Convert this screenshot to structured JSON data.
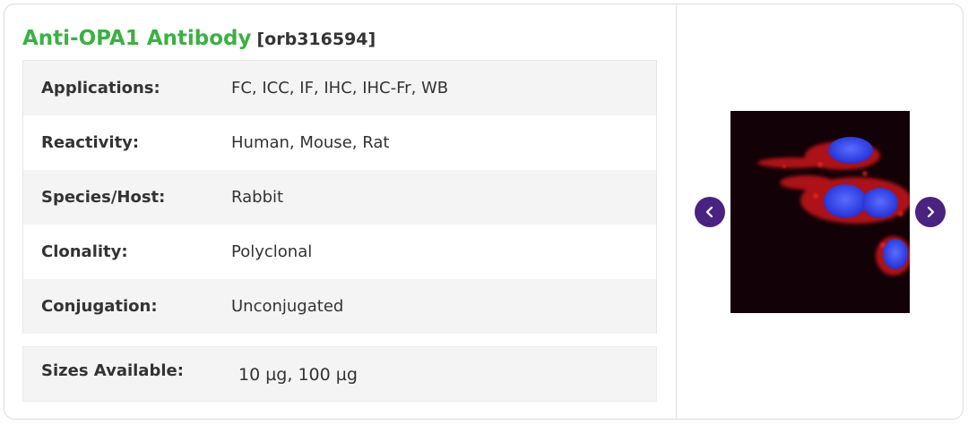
{
  "product": {
    "name": "Anti-OPA1 Antibody",
    "code": "[orb316594]"
  },
  "specs": [
    {
      "label": "Applications:",
      "value": "FC,  ICC,  IF,  IHC,  IHC-Fr,  WB"
    },
    {
      "label": "Reactivity:",
      "value": "Human, Mouse, Rat"
    },
    {
      "label": "Species/Host:",
      "value": "Rabbit"
    },
    {
      "label": "Clonality:",
      "value": "Polyclonal"
    },
    {
      "label": "Conjugation:",
      "value": "Unconjugated"
    }
  ],
  "sizes": {
    "label": "Sizes Available:",
    "value": "10 µg, 100 µg"
  },
  "gallery": {
    "prev_icon": "chevron-left-icon",
    "next_icon": "chevron-right-icon",
    "accent_color": "#4a2380"
  },
  "colors": {
    "title_green": "#3cb043",
    "row_shade": "#f4f4f4"
  }
}
